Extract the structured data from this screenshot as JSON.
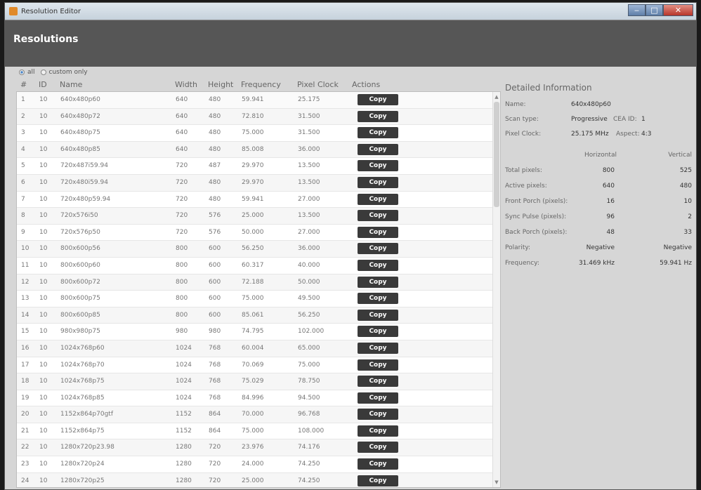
{
  "window": {
    "title": "Resolution Editor"
  },
  "header": {
    "title": "Resolutions"
  },
  "filters": {
    "all_label": "all",
    "custom_label": "custom only"
  },
  "columns": {
    "num": "#",
    "id": "ID",
    "name": "Name",
    "width": "Width",
    "height": "Height",
    "frequency": "Frequency",
    "pixel_clock": "Pixel Clock",
    "actions": "Actions"
  },
  "copy_label": "Copy",
  "rows": [
    {
      "num": "1",
      "id": "10",
      "name": "640x480p60",
      "width": "640",
      "height": "480",
      "frequency": "59.941",
      "pixel_clock": "25.175"
    },
    {
      "num": "2",
      "id": "10",
      "name": "640x480p72",
      "width": "640",
      "height": "480",
      "frequency": "72.810",
      "pixel_clock": "31.500"
    },
    {
      "num": "3",
      "id": "10",
      "name": "640x480p75",
      "width": "640",
      "height": "480",
      "frequency": "75.000",
      "pixel_clock": "31.500"
    },
    {
      "num": "4",
      "id": "10",
      "name": "640x480p85",
      "width": "640",
      "height": "480",
      "frequency": "85.008",
      "pixel_clock": "36.000"
    },
    {
      "num": "5",
      "id": "10",
      "name": "720x487i59.94",
      "width": "720",
      "height": "487",
      "frequency": "29.970",
      "pixel_clock": "13.500"
    },
    {
      "num": "6",
      "id": "10",
      "name": "720x480i59.94",
      "width": "720",
      "height": "480",
      "frequency": "29.970",
      "pixel_clock": "13.500"
    },
    {
      "num": "7",
      "id": "10",
      "name": "720x480p59.94",
      "width": "720",
      "height": "480",
      "frequency": "59.941",
      "pixel_clock": "27.000"
    },
    {
      "num": "8",
      "id": "10",
      "name": "720x576i50",
      "width": "720",
      "height": "576",
      "frequency": "25.000",
      "pixel_clock": "13.500"
    },
    {
      "num": "9",
      "id": "10",
      "name": "720x576p50",
      "width": "720",
      "height": "576",
      "frequency": "50.000",
      "pixel_clock": "27.000"
    },
    {
      "num": "10",
      "id": "10",
      "name": "800x600p56",
      "width": "800",
      "height": "600",
      "frequency": "56.250",
      "pixel_clock": "36.000"
    },
    {
      "num": "11",
      "id": "10",
      "name": "800x600p60",
      "width": "800",
      "height": "600",
      "frequency": "60.317",
      "pixel_clock": "40.000"
    },
    {
      "num": "12",
      "id": "10",
      "name": "800x600p72",
      "width": "800",
      "height": "600",
      "frequency": "72.188",
      "pixel_clock": "50.000"
    },
    {
      "num": "13",
      "id": "10",
      "name": "800x600p75",
      "width": "800",
      "height": "600",
      "frequency": "75.000",
      "pixel_clock": "49.500"
    },
    {
      "num": "14",
      "id": "10",
      "name": "800x600p85",
      "width": "800",
      "height": "600",
      "frequency": "85.061",
      "pixel_clock": "56.250"
    },
    {
      "num": "15",
      "id": "10",
      "name": "980x980p75",
      "width": "980",
      "height": "980",
      "frequency": "74.795",
      "pixel_clock": "102.000"
    },
    {
      "num": "16",
      "id": "10",
      "name": "1024x768p60",
      "width": "1024",
      "height": "768",
      "frequency": "60.004",
      "pixel_clock": "65.000"
    },
    {
      "num": "17",
      "id": "10",
      "name": "1024x768p70",
      "width": "1024",
      "height": "768",
      "frequency": "70.069",
      "pixel_clock": "75.000"
    },
    {
      "num": "18",
      "id": "10",
      "name": "1024x768p75",
      "width": "1024",
      "height": "768",
      "frequency": "75.029",
      "pixel_clock": "78.750"
    },
    {
      "num": "19",
      "id": "10",
      "name": "1024x768p85",
      "width": "1024",
      "height": "768",
      "frequency": "84.996",
      "pixel_clock": "94.500"
    },
    {
      "num": "20",
      "id": "10",
      "name": "1152x864p70gtf",
      "width": "1152",
      "height": "864",
      "frequency": "70.000",
      "pixel_clock": "96.768"
    },
    {
      "num": "21",
      "id": "10",
      "name": "1152x864p75",
      "width": "1152",
      "height": "864",
      "frequency": "75.000",
      "pixel_clock": "108.000"
    },
    {
      "num": "22",
      "id": "10",
      "name": "1280x720p23.98",
      "width": "1280",
      "height": "720",
      "frequency": "23.976",
      "pixel_clock": "74.176"
    },
    {
      "num": "23",
      "id": "10",
      "name": "1280x720p24",
      "width": "1280",
      "height": "720",
      "frequency": "24.000",
      "pixel_clock": "74.250"
    },
    {
      "num": "24",
      "id": "10",
      "name": "1280x720p25",
      "width": "1280",
      "height": "720",
      "frequency": "25.000",
      "pixel_clock": "74.250"
    }
  ],
  "detail": {
    "title": "Detailed Information",
    "name_label": "Name:",
    "name_value": "640x480p60",
    "scan_label": "Scan type:",
    "scan_value": "Progressive",
    "cea_label": "CEA ID:",
    "cea_value": "1",
    "clock_label": "Pixel Clock:",
    "clock_value": "25.175 MHz",
    "aspect_label": "Aspect:",
    "aspect_value": "4:3",
    "horizontal_header": "Horizontal",
    "vertical_header": "Vertical",
    "total_label": "Total pixels:",
    "total_h": "800",
    "total_v": "525",
    "active_label": "Active pixels:",
    "active_h": "640",
    "active_v": "480",
    "front_label": "Front Porch (pixels):",
    "front_h": "16",
    "front_v": "10",
    "sync_label": "Sync Pulse (pixels):",
    "sync_h": "96",
    "sync_v": "2",
    "back_label": "Back Porch (pixels):",
    "back_h": "48",
    "back_v": "33",
    "polarity_label": "Polarity:",
    "polarity_h": "Negative",
    "polarity_v": "Negative",
    "freq_label": "Frequency:",
    "freq_h": "31.469 kHz",
    "freq_v": "59.941 Hz"
  }
}
